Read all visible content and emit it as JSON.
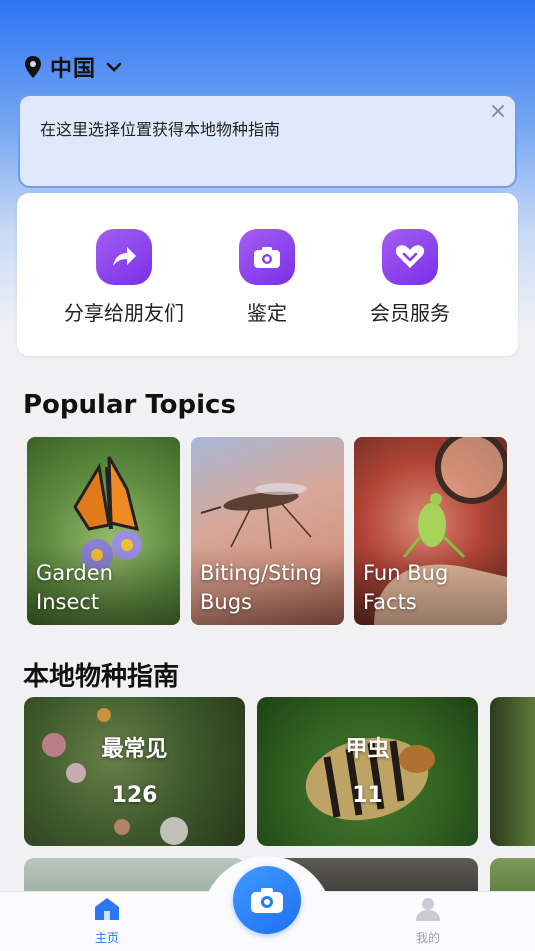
{
  "location": {
    "name": "中国"
  },
  "tooltip": {
    "text": "在这里选择位置获得本地物种指南"
  },
  "actions": [
    {
      "label": "分享给朋友们",
      "icon": "share-arrow-icon"
    },
    {
      "label": "鉴定",
      "icon": "camera-icon"
    },
    {
      "label": "会员服务",
      "icon": "vip-heart-icon"
    }
  ],
  "popular": {
    "title": "Popular Topics",
    "items": [
      {
        "line1": "Garden",
        "line2": "Insect"
      },
      {
        "line1": "Biting/Sting",
        "line2": "Bugs"
      },
      {
        "line1": "Fun Bug",
        "line2": "Facts"
      }
    ]
  },
  "guide": {
    "title": "本地物种指南",
    "items": [
      {
        "name": "最常见",
        "count": "126"
      },
      {
        "name": "甲虫",
        "count": "11"
      }
    ]
  },
  "tabs": {
    "home": "主页",
    "mine": "我的"
  },
  "colors": {
    "accent": "#2f74f4",
    "purple": "#8a3ff0"
  }
}
